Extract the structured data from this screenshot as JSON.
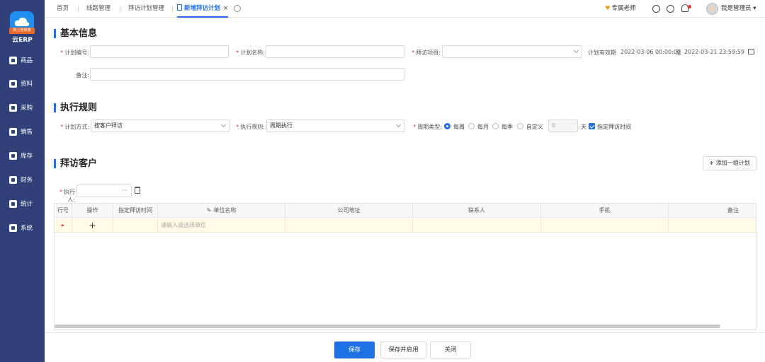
{
  "sidebar": {
    "logo_badge": "网上管家婆",
    "brand": "云ERP",
    "items": [
      {
        "label": "商品",
        "icon": "goods-icon"
      },
      {
        "label": "资料",
        "icon": "data-icon"
      },
      {
        "label": "采购",
        "icon": "purchase-icon"
      },
      {
        "label": "销售",
        "icon": "sales-icon"
      },
      {
        "label": "库存",
        "icon": "inventory-icon"
      },
      {
        "label": "财务",
        "icon": "finance-icon"
      },
      {
        "label": "统计",
        "icon": "stats-icon"
      },
      {
        "label": "系统",
        "icon": "system-icon"
      }
    ]
  },
  "tabs": {
    "items": [
      "首页",
      "线路管理",
      "拜访计划管理"
    ],
    "active": "新增拜访计划",
    "close": "×"
  },
  "header": {
    "advisor": "专属老师",
    "user": "我是管理员"
  },
  "basic": {
    "title": "基本信息",
    "plan_no_label": "计划编号:",
    "plan_no_value": "",
    "plan_name_label": "计划名称:",
    "plan_name_value": "",
    "visit_item_label": "拜访项目:",
    "valid_label": "计划有效期",
    "date_start": "2022-03-06 00:00:00",
    "date_to": "至",
    "date_end": "2022-03-21 23:59:59",
    "remark_label": "备注:"
  },
  "rules": {
    "title": "执行规则",
    "method_label": "计划方式:",
    "method_value": "按客户拜访",
    "exec_label": "执行规则:",
    "exec_value": "周期执行",
    "cycle_label": "周期类型:",
    "options": [
      "每周",
      "每月",
      "每季",
      "自定义"
    ],
    "selected": "每周",
    "days_value": "0",
    "days_unit": "天",
    "check_label": "指定拜访时间"
  },
  "customers": {
    "title": "拜访客户",
    "add_button": "添加一组计划",
    "executor_label": "执行人:",
    "executor_value": "···"
  },
  "table": {
    "columns": [
      "行号",
      "操作",
      "指定拜访时间",
      "单位名称",
      "公司地址",
      "联系人",
      "手机",
      "备注"
    ],
    "row": {
      "add": "+",
      "placeholder": "请输入或选择单位"
    }
  },
  "footer": {
    "save": "保存",
    "save_enable": "保存并启用",
    "close": "关闭"
  },
  "colors": {
    "sidebar": "#2f4178",
    "accent": "#1f6fe5",
    "row_highlight": "#fff9e6"
  }
}
